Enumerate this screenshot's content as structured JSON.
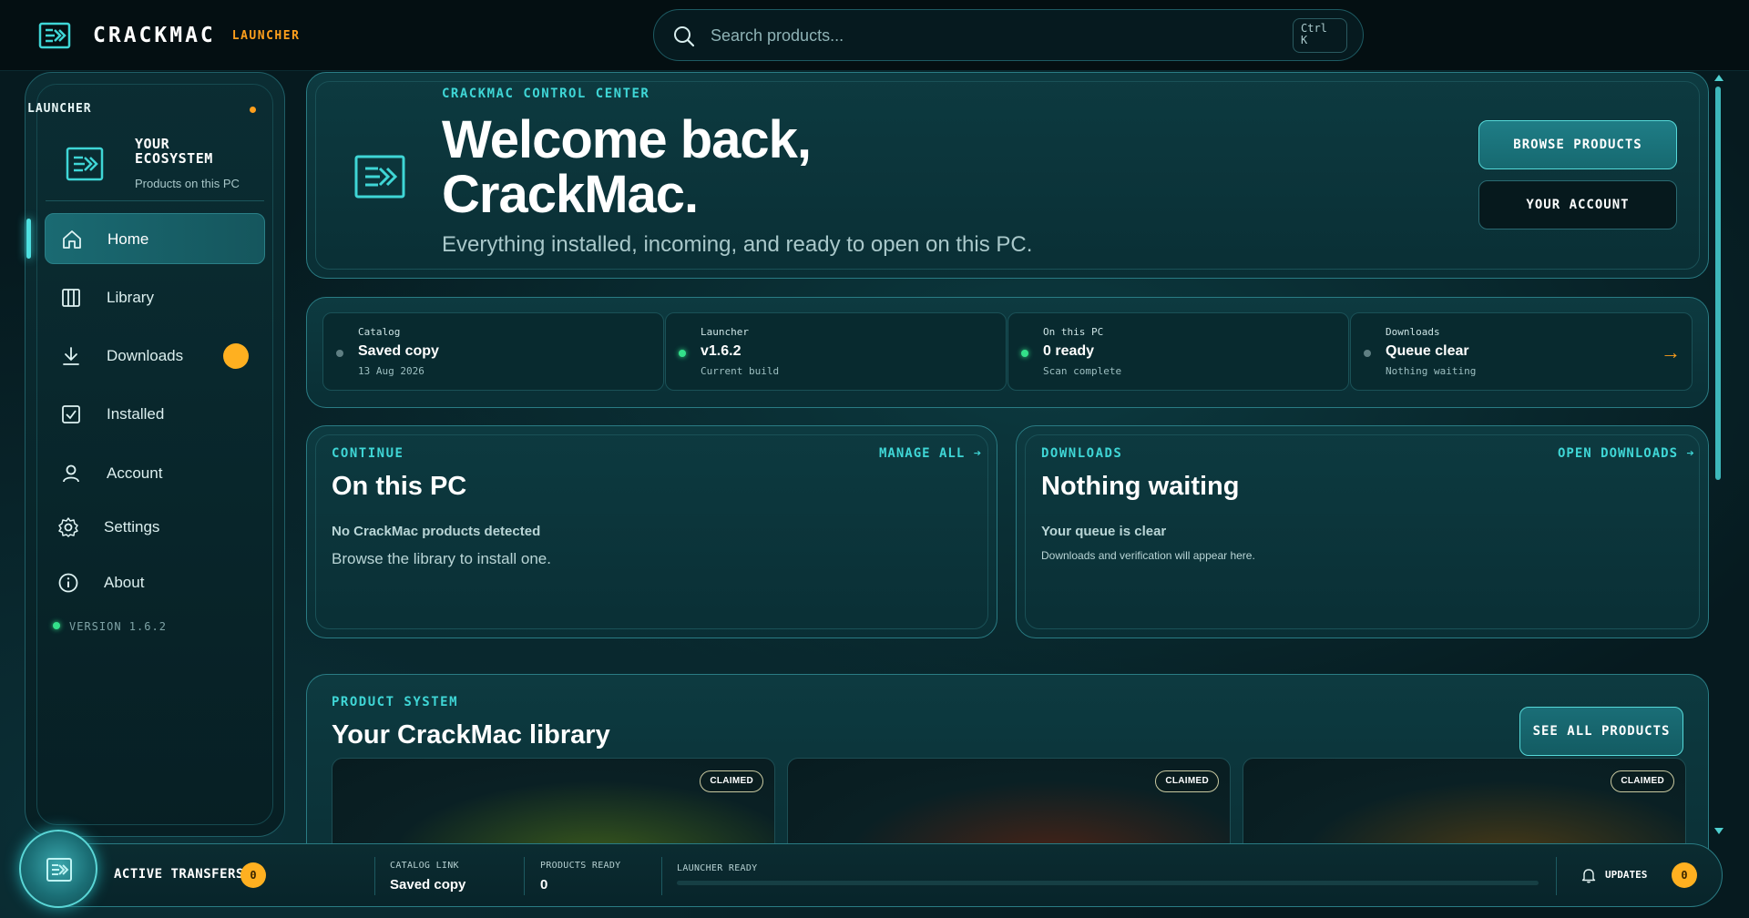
{
  "app": {
    "name": "CRACKMAC",
    "tag": "LAUNCHER"
  },
  "search": {
    "placeholder": "Search products...",
    "shortcut": "Ctrl\nK"
  },
  "sidebar": {
    "label": "LAUNCHER",
    "ecosystem_title": "YOUR ECOSYSTEM",
    "ecosystem_subtitle": "Products on this PC",
    "items": [
      {
        "label": "Home",
        "icon": "home-icon",
        "active": true
      },
      {
        "label": "Library",
        "icon": "library-icon"
      },
      {
        "label": "Downloads",
        "icon": "download-icon"
      },
      {
        "label": "Installed",
        "icon": "checkbox-icon"
      },
      {
        "label": "Account",
        "icon": "user-icon"
      },
      {
        "label": "Settings",
        "icon": "gear-icon"
      },
      {
        "label": "About",
        "icon": "info-icon"
      }
    ],
    "version": "VERSION 1.6.2"
  },
  "hero": {
    "eyebrow": "CRACKMAC CONTROL CENTER",
    "title": "Welcome back, CrackMac.",
    "subtitle": "Everything installed, incoming, and ready to open on this PC.",
    "primary_button": "BROWSE PRODUCTS",
    "secondary_button": "YOUR ACCOUNT"
  },
  "status": [
    {
      "label": "Catalog",
      "value": "Saved copy",
      "note": "13 Aug 2026",
      "dot_color": "#5f7f83"
    },
    {
      "label": "Launcher",
      "value": "v1.6.2",
      "note": "Current build",
      "dot_color": "#33e08a"
    },
    {
      "label": "On this PC",
      "value": "0 ready",
      "note": "Scan complete",
      "dot_color": "#33e08a"
    },
    {
      "label": "Downloads",
      "value": "Queue clear",
      "note": "Nothing waiting",
      "dot_color": "#5f7f83",
      "arrow": "→"
    }
  ],
  "continue_card": {
    "eyebrow": "CONTINUE",
    "link": "MANAGE ALL ➔",
    "title": "On this PC",
    "strong": "No CrackMac products detected",
    "text": "Browse the library to install one."
  },
  "downloads_card": {
    "eyebrow": "DOWNLOADS",
    "link": "OPEN DOWNLOADS ➔",
    "title": "Nothing waiting",
    "strong": "Your queue is clear",
    "text": "Downloads and verification will appear here."
  },
  "library": {
    "eyebrow": "PRODUCT SYSTEM",
    "title": "Your CrackMac library",
    "button": "SEE ALL PRODUCTS",
    "products": [
      {
        "badge": "CLAIMED",
        "glow": "#3b5a1c"
      },
      {
        "badge": "CLAIMED",
        "glow": "#4a2316"
      },
      {
        "badge": "CLAIMED",
        "glow": "#4a3a16"
      }
    ]
  },
  "bottombar": {
    "active_transfers_label": "ACTIVE TRANSFERS",
    "active_transfers_count": "0",
    "catalog_link_label": "CATALOG LINK",
    "catalog_link_value": "Saved copy",
    "products_ready_label": "PRODUCTS READY",
    "products_ready_value": "0",
    "launcher_ready_label": "LAUNCHER READY",
    "launcher_ready_progress": 0,
    "updates_label": "UPDATES",
    "updates_count": "0"
  },
  "colors": {
    "accent": "#3fd6d6",
    "orange": "#ff9f1c",
    "badge": "#ffb020",
    "green": "#33e08a",
    "background": "#061a1f"
  }
}
